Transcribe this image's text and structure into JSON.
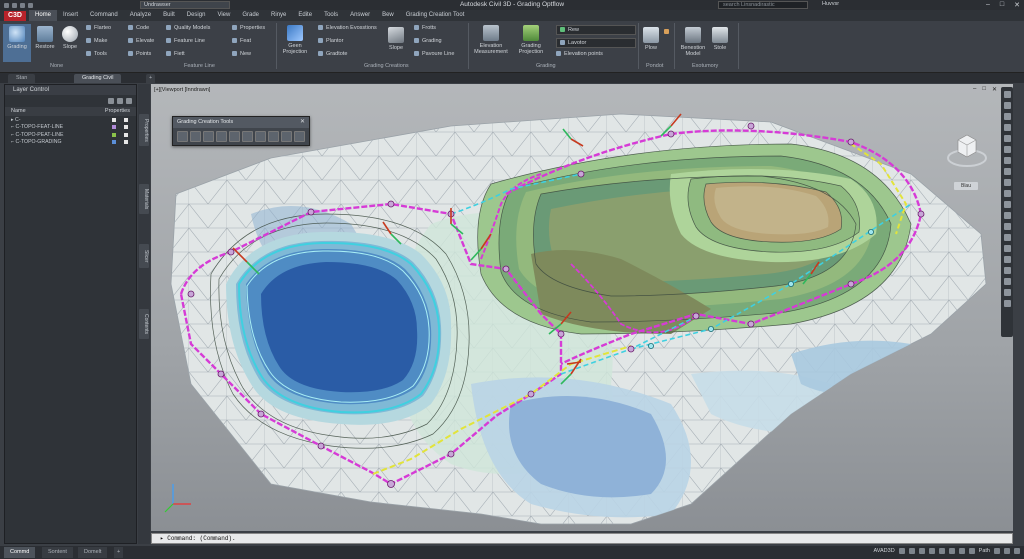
{
  "app": {
    "title": "Autodesk Civil 3D - Grading Optflow",
    "workspace": "Undrawser",
    "search_placeholder": "search Linsnadirastic",
    "user": "Huvvsr",
    "window_controls": [
      "–",
      "□",
      "✕"
    ]
  },
  "menu": {
    "logo": "C3D",
    "tabs": [
      "Home",
      "Insert",
      "Command",
      "Analyze",
      "Built",
      "Design",
      "View",
      "Grade",
      "Rinye",
      "Edite",
      "Tools",
      "Answer",
      "Bew",
      "Grading Creation Toot"
    ],
    "active": "Home"
  },
  "ribbon": {
    "big_buttons": [
      "Grading",
      "Restore",
      "Slope",
      "Geen Projection",
      "Elevation Measurement",
      "Grading Projection",
      "Slope",
      "Plow",
      "Benestion Model",
      "Stole"
    ],
    "small_items": {
      "col1": [
        "Flarteo",
        "Make",
        "Tools"
      ],
      "col2": [
        "Code",
        "Elevate",
        "Points"
      ],
      "col3": [
        "Quality Models",
        "Feature Line",
        "Fiett"
      ],
      "col4": [
        "Properties",
        "Feat",
        "New"
      ],
      "col5": [
        "Elevation Evosstions",
        "Plantor",
        "Gradtote"
      ],
      "col6": [
        "Frotts",
        "Grading",
        "Pavoure Line"
      ],
      "col7": [
        "Rew",
        "Lavotor",
        "Elevation points"
      ]
    },
    "group_labels": [
      "None",
      "Feature Line",
      "Grading Creations",
      "Grading",
      "Pondot",
      "Exotumory"
    ]
  },
  "doc_tabs": [
    "Stan",
    "Grading Civil"
  ],
  "layer_panel": {
    "title": "Layer Control",
    "col_name": "Name",
    "col_props": "Properties",
    "layers": [
      {
        "name": "C-",
        "color": "#e6e6e6"
      },
      {
        "name": "C-TOPO-FEAT-LINE",
        "color": "#b18ad8"
      },
      {
        "name": "C-TOPO-PEAT-LINE",
        "color": "#8bc34a"
      },
      {
        "name": "C-TOPO-GRADING",
        "color": "#5b8fd8"
      }
    ]
  },
  "side_tabs": [
    "Properties",
    "Materials",
    "Slicer",
    "Contents"
  ],
  "viewport": {
    "label": "[+][Viewport [Inndrawn]",
    "cube_label": "Blau",
    "controls": [
      "–",
      "□",
      "✕"
    ]
  },
  "floating_toolbar": {
    "title": "Grading Creation Tools",
    "tool_count": 10
  },
  "command_line": "Command: (Command).",
  "status_bar": {
    "tabs": [
      "Commd",
      "Sontent",
      "Domelt"
    ],
    "active": "Commd",
    "right_items": [
      "AVAD3D",
      "Path"
    ]
  },
  "colors": {
    "grading_line": "#d63bd6",
    "feature_line": "#3fd0e0",
    "daylight_line": "#e2e43a",
    "pond_fill": "#2a5ca6",
    "mound_fill": "#c2b38a"
  }
}
